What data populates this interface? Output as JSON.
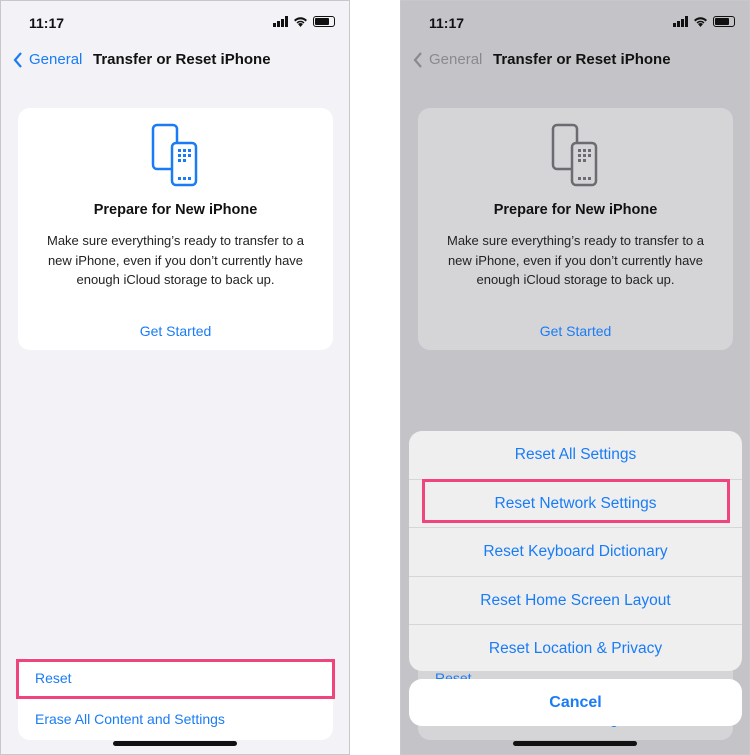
{
  "status": {
    "time": "11:17"
  },
  "nav": {
    "back_label": "General",
    "title": "Transfer or Reset iPhone"
  },
  "card": {
    "title": "Prepare for New iPhone",
    "body": "Make sure everything’s ready to transfer to a new iPhone, even if you don’t currently have enough iCloud storage to back up.",
    "action": "Get Started"
  },
  "list": {
    "reset": "Reset",
    "erase": "Erase All Content and Settings"
  },
  "sheet": {
    "options": [
      "Reset All Settings",
      "Reset Network Settings",
      "Reset Keyboard Dictionary",
      "Reset Home Screen Layout",
      "Reset Location & Privacy"
    ],
    "cancel": "Cancel"
  },
  "colors": {
    "accent": "#1a7cf5",
    "highlight": "#f0447c"
  }
}
